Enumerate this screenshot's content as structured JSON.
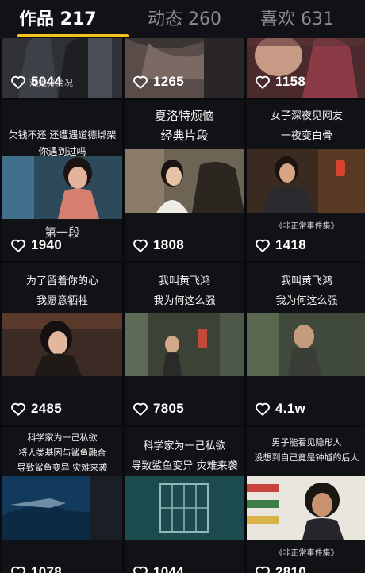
{
  "tabs": [
    {
      "label": "作品 217"
    },
    {
      "label": "动态 260"
    },
    {
      "label": "喜欢 631"
    }
  ],
  "videos": [
    {
      "likes": "5044",
      "overlay": "观她分情况"
    },
    {
      "likes": "1265"
    },
    {
      "likes": "1158"
    },
    {
      "caption": [
        "欠钱不还 还遭遇道德绑架",
        "你遇到过吗"
      ],
      "likes": "1940",
      "extra": "第一段"
    },
    {
      "caption": [
        "夏洛特烦恼",
        "经典片段"
      ],
      "likes": "1808"
    },
    {
      "caption": [
        "女子深夜见网友",
        "一夜变白骨"
      ],
      "likes": "1418",
      "extra": "《非正常事件集》"
    },
    {
      "caption": [
        "为了留着你的心",
        "我愿意牺牲"
      ],
      "likes": "2485"
    },
    {
      "caption": [
        "我叫黄飞鸿",
        "我为何这么强"
      ],
      "likes": "7805"
    },
    {
      "caption": [
        "我叫黄飞鸿",
        "我为何这么强"
      ],
      "likes": "4.1w"
    },
    {
      "caption": [
        "科学家为一己私欲",
        "将人类基因与鲨鱼融合",
        "导致鲨鱼变异 灾难来袭"
      ],
      "likes": "1078"
    },
    {
      "caption": [
        "科学家为一己私欲",
        "导致鲨鱼变异 灾难来袭"
      ],
      "likes": "1044"
    },
    {
      "caption": [
        "男子能看见隐形人",
        "没想到自己竟是钟馗的后人"
      ],
      "likes": "2810",
      "extra": "《非正常事件集》"
    }
  ],
  "icons": {
    "like": "heart-outline-icon"
  },
  "colors": {
    "accent": "#f4c21c",
    "background": "#0e0f14"
  }
}
